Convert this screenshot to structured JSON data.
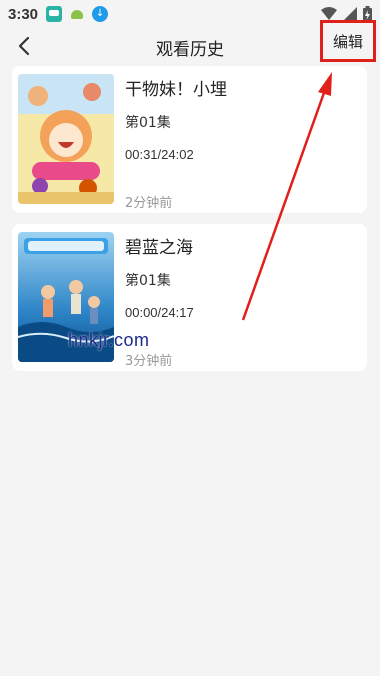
{
  "status_bar": {
    "time": "3:30",
    "icons": [
      "app-notification-icon",
      "android-icon",
      "download-icon",
      "wifi-icon",
      "signal-icon",
      "battery-charging-icon"
    ]
  },
  "header": {
    "title": "观看历史",
    "edit_label": "编辑",
    "back_icon": "chevron-left-icon"
  },
  "history": [
    {
      "title": "干物妹！小埋",
      "episode": "第01集",
      "progress": "00:31/24:02",
      "ago": "2分钟前"
    },
    {
      "title": "碧蓝之海",
      "episode": "第01集",
      "progress": "00:00/24:17",
      "ago": "3分钟前"
    }
  ],
  "watermark": "hnkjr.com",
  "colors": {
    "highlight": "#e0201b",
    "background": "#f4f4f4",
    "card": "#ffffff"
  }
}
